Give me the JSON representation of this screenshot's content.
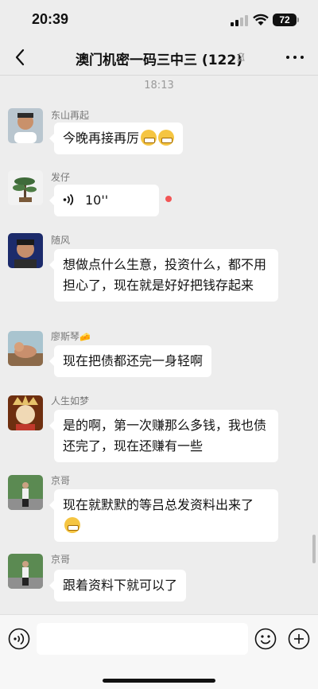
{
  "status_bar": {
    "time": "20:39",
    "battery": "72"
  },
  "nav": {
    "title": "澳门机密一码三中三 (122)"
  },
  "timestamp": "18:13",
  "messages": [
    {
      "sender": "东山再起",
      "text": "今晚再接再厉",
      "emoji": "grimacing-face x2"
    },
    {
      "sender": "发仔",
      "voice_duration": "10''",
      "unread": true
    },
    {
      "sender": "随风",
      "text": "想做点什么生意，投资什么，都不用担心了，现在就是好好把钱存起来"
    },
    {
      "sender": "廖斯琴",
      "sender_badge": "🧀",
      "text": "现在把债都还完一身轻啊"
    },
    {
      "sender": "人生如梦",
      "text": "是的啊，第一次赚那么多钱，我也债还完了，现在还赚有一些"
    },
    {
      "sender": "京哥",
      "text": "现在就默默的等吕总发资料出来了",
      "emoji": "hugging-face"
    },
    {
      "sender": "京哥",
      "text": "跟着资料下就可以了"
    }
  ],
  "colors": {
    "background": "#ededed",
    "bubble": "#ffffff",
    "unread_dot": "#f25555",
    "input_bar": "#f7f7f7"
  },
  "icons": [
    "back-icon",
    "mute-icon",
    "more-icon",
    "voice-wave-icon",
    "voice-toggle-icon",
    "emoji-icon",
    "plus-icon"
  ]
}
